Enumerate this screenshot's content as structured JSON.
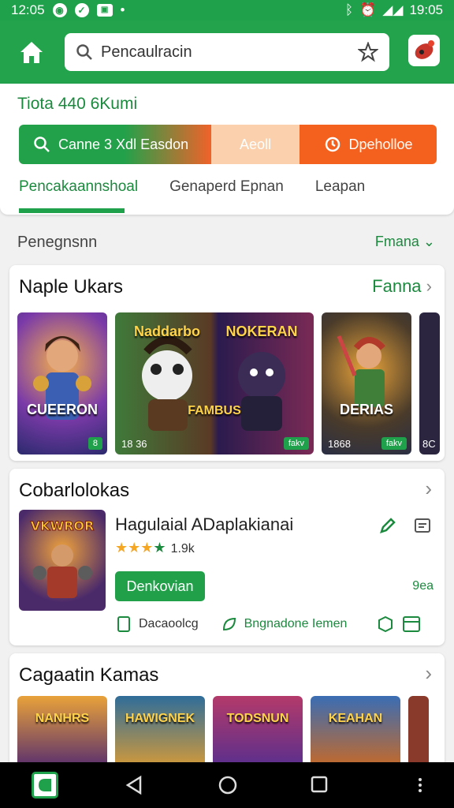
{
  "status_bar": {
    "time_left": "12:05",
    "time_right": "19:05"
  },
  "search": {
    "text": "Pencaulracin"
  },
  "top_card": {
    "title": "Tiota 440 6Kumi",
    "buttons": [
      "Canne 3 Xdl Easdon",
      "Aeoll",
      "Dpeholloe"
    ],
    "tabs": [
      "Pencakaannshoal",
      "Genaperd Epnan",
      "Leapan"
    ]
  },
  "section": {
    "title": "Penegnsnn",
    "more": "Fmana"
  },
  "panel1": {
    "title": "Naple Ukars",
    "link": "Fanna",
    "games": [
      {
        "name": "CUEERON",
        "rating": "",
        "badge": "8"
      },
      {
        "name": "NOKERAN",
        "top_name": "Naddarbo",
        "rating": "18 36",
        "badge": "fakv",
        "sub": "FAMBUS"
      },
      {
        "name": "DERIAS",
        "rating": "1868",
        "badge": "fakv"
      }
    ],
    "extra_rating": "8C"
  },
  "panel2": {
    "title": "Cobarlolokas",
    "app_name": "Hagulaial ADaplakianai",
    "rating_count": "1.9k",
    "download": "Denkovian",
    "size": "9ea",
    "foot_left": "Dacaoolcg",
    "foot_right": "Bngnadone Iemen"
  },
  "panel3": {
    "title": "Cagaatin Kamas",
    "games": [
      "NANHRS",
      "HAWIGNEK",
      "TODSNUN",
      "KEAHAN"
    ]
  }
}
